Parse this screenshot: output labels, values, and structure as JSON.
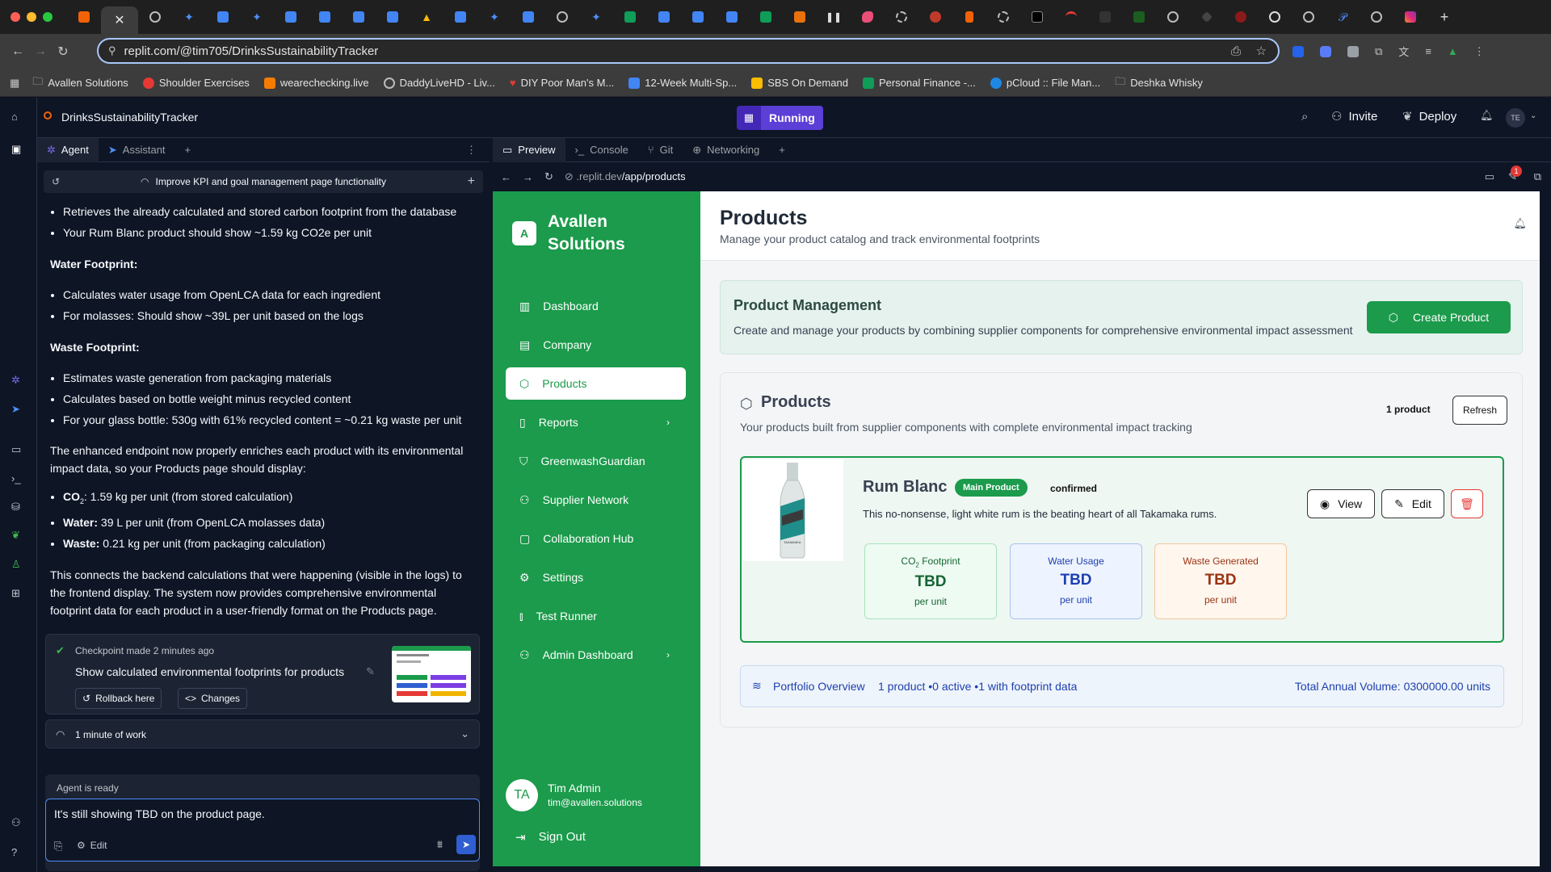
{
  "browser": {
    "url": "replit.com/@tim705/DrinksSustainabilityTracker",
    "bookmarks": [
      "Avallen Solutions",
      "Shoulder Exercises",
      "wearechecking.live",
      "DaddyLiveHD - Liv...",
      "DIY Poor Man's M...",
      "12-Week Multi-Sp...",
      "SBS On Demand",
      "Personal Finance -...",
      "pCloud :: File Man...",
      "Deshka Whisky"
    ]
  },
  "replit": {
    "project": "DrinksSustainabilityTracker",
    "status": "Running",
    "invite": "Invite",
    "deploy": "Deploy",
    "avatar": "TE"
  },
  "agent": {
    "tabs": [
      "Agent",
      "Assistant"
    ],
    "thread_title": "Improve KPI and goal management page functionality",
    "b1": "Retrieves the already calculated and stored carbon footprint from the database",
    "b2": "Your Rum Blanc product should show ~1.59 kg CO2e per unit",
    "water_h": "Water Footprint:",
    "w1": "Calculates water usage from OpenLCA data for each ingredient",
    "w2": "For molasses: Should show ~39L per unit based on the logs",
    "waste_h": "Waste Footprint:",
    "x1": "Estimates waste generation from packaging materials",
    "x2": "Calculates based on bottle weight minus recycled content",
    "x3": "For your glass bottle: 530g with 61% recycled content = ~0.21 kg waste per unit",
    "p1": "The enhanced endpoint now properly enriches each product with its environmental impact data, so your Products page should display:",
    "co2_label": "CO",
    "co2_sub": "2",
    "co2_text": ": 1.59 kg per unit (from stored calculation)",
    "water_label": "Water:",
    "water_text": " 39 L per unit (from OpenLCA molasses data)",
    "waste_label": "Waste:",
    "waste_text": " 0.21 kg per unit (from packaging calculation)",
    "p2": "This connects the backend calculations that were happening (visible in the logs) to the frontend display. The system now provides comprehensive environmental footprint data for each product in a user-friendly format on the Products page.",
    "checkpoint": "Checkpoint made 2 minutes ago",
    "checkpoint_desc": "Show calculated environmental footprints for products",
    "rollback": "Rollback here",
    "changes": "Changes",
    "work": "1 minute of work",
    "ready": "Agent is ready",
    "input": "It's still showing TBD on the product page.",
    "edit": "Edit"
  },
  "preview": {
    "tabs": [
      "Preview",
      "Console",
      "Git",
      "Networking"
    ],
    "url_host": ".replit.dev",
    "url_path": "/app/products",
    "badge": "1"
  },
  "app": {
    "brand_initial": "A",
    "brand": "Avallen Solutions",
    "nav": [
      "Dashboard",
      "Company",
      "Products",
      "Reports",
      "GreenwashGuardian",
      "Supplier Network",
      "Collaboration Hub",
      "Settings",
      "Test Runner",
      "Admin Dashboard"
    ],
    "user_initials": "TA",
    "user_name": "Tim Admin",
    "user_email": "tim@avallen.solutions",
    "signout": "Sign Out",
    "page_title": "Products",
    "page_sub": "Manage your product catalog and track environmental footprints",
    "pm_title": "Product Management",
    "pm_desc": "Create and manage your products by combining supplier components for comprehensive environmental impact assessment",
    "create": "Create Product",
    "list_title": "Products",
    "list_sub": "Your products built from supplier components with complete environmental impact tracking",
    "count": "1 product",
    "refresh": "Refresh",
    "product": {
      "name": "Rum Blanc",
      "tag": "Main Product",
      "status": "confirmed",
      "desc": "This no-nonsense, light white rum is the beating heart of all Takamaka rums.",
      "view": "View",
      "edit": "Edit",
      "co2_label": "CO",
      "co2_sub": "2",
      "co2_rest": " Footprint",
      "co2_val": "TBD",
      "water_label": "Water Usage",
      "water_val": "TBD",
      "waste_label": "Waste Generated",
      "waste_val": "TBD",
      "unit": "per unit",
      "bottle_text": "TAKAMAKA"
    },
    "portfolio": "Portfolio Overview",
    "portfolio_stats": "1 product •0 active •1 with footprint data",
    "portfolio_total": "Total Annual Volume: 0300000.00 units"
  },
  "colors": {
    "brand_green": "#1b9b4b",
    "replit_bg": "#0e1525",
    "accent_blue": "#2f5fd0"
  }
}
